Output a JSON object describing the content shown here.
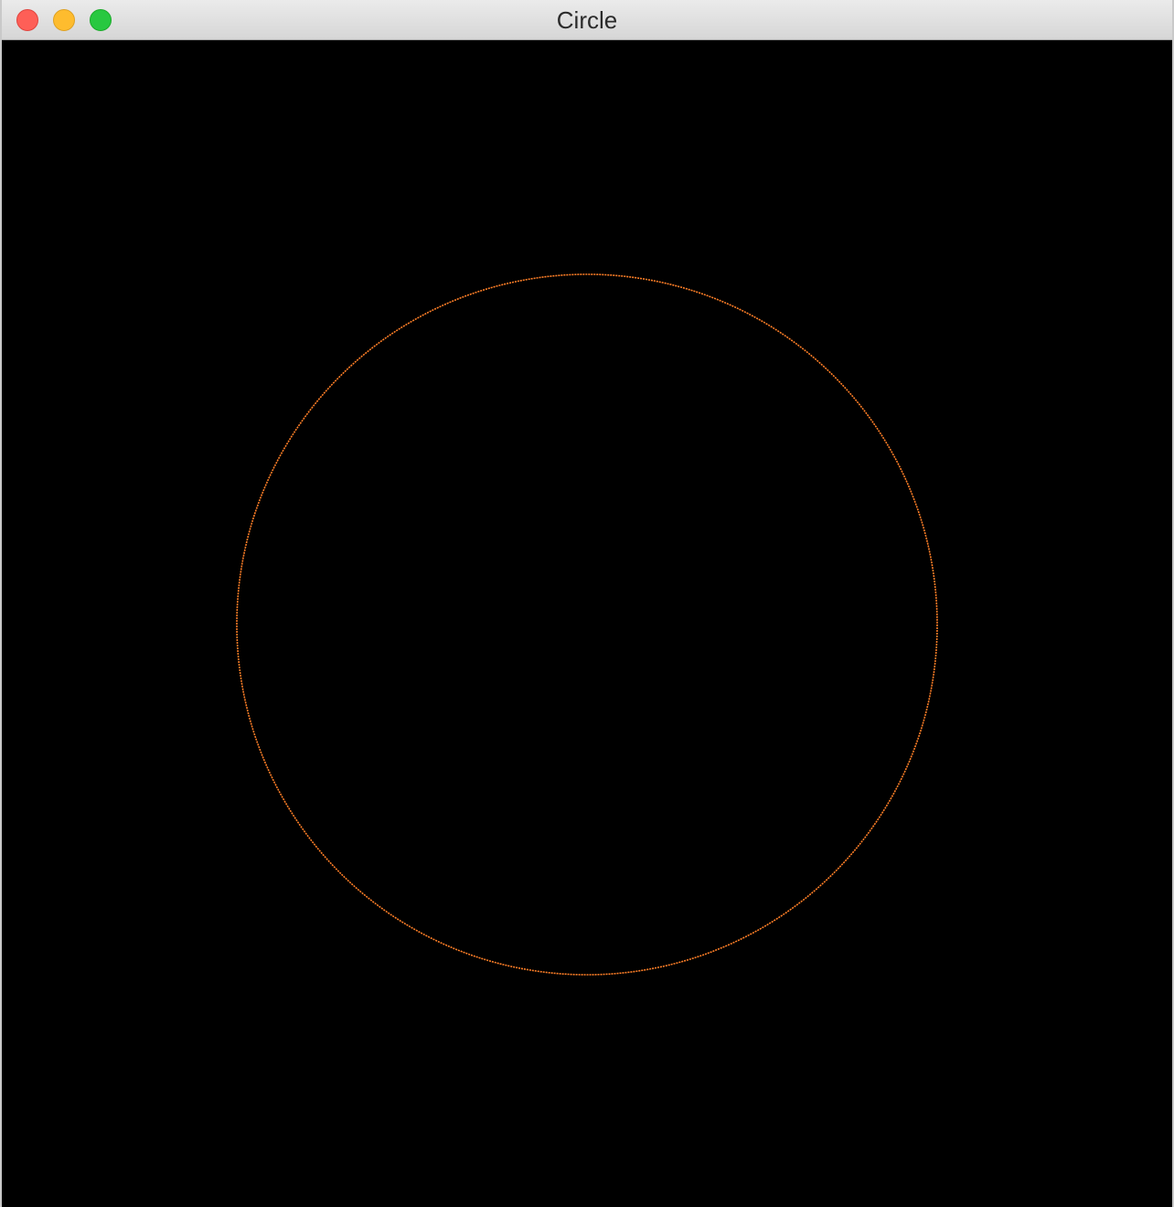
{
  "window": {
    "title": "Circle"
  },
  "titlebar_buttons": [
    {
      "name": "close-button",
      "color": "#fe5f57"
    },
    {
      "name": "minimize-button",
      "color": "#febc2e"
    },
    {
      "name": "zoom-button",
      "color": "#28c840"
    }
  ],
  "canvas": {
    "background": "#000000",
    "shape": "circle",
    "stroke_color": "#ff7f27"
  }
}
